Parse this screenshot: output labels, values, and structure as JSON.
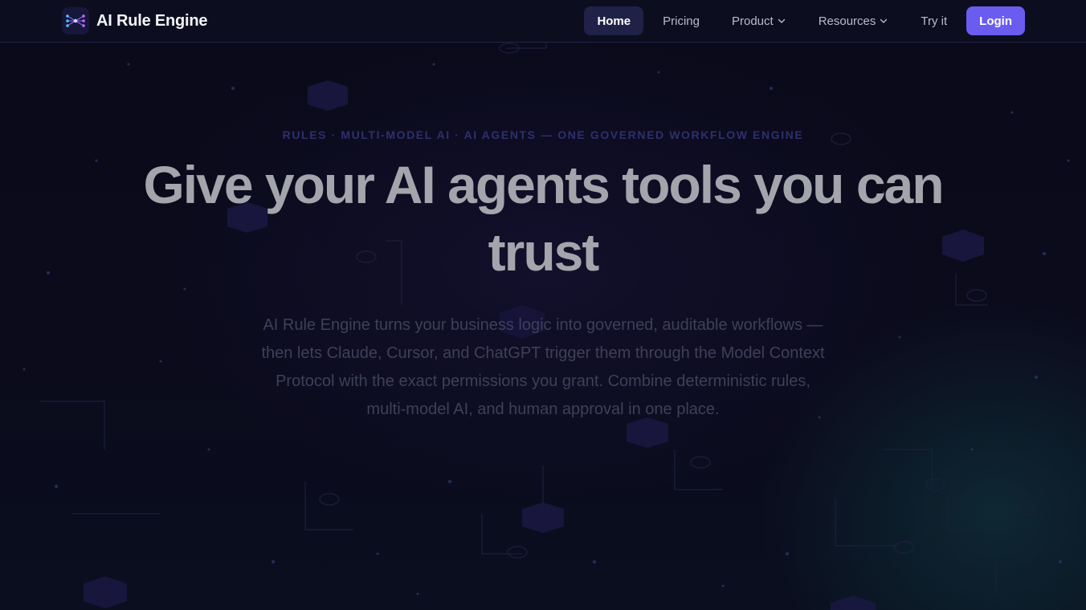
{
  "brand": {
    "name": "AI Rule Engine",
    "logo_icon": "neural-network-logo-icon"
  },
  "nav": {
    "items": [
      {
        "label": "Home",
        "active": true
      },
      {
        "label": "Pricing"
      },
      {
        "label": "Product",
        "has_dropdown": true
      },
      {
        "label": "Resources",
        "has_dropdown": true
      },
      {
        "label": "Try it"
      }
    ],
    "login_label": "Login"
  },
  "hero": {
    "eyebrow": "RULES · MULTI-MODEL AI · AI AGENTS — ONE GOVERNED WORKFLOW ENGINE",
    "headline_line1": "Give your AI agents tools you can",
    "headline_line2": "trust",
    "subtext": "AI Rule Engine turns your business logic into governed, auditable workflows — then lets Claude, Cursor, and ChatGPT trigger them through the Model Context Protocol with the exact permissions you grant. Combine deterministic rules, multi-model AI, and human approval in one place."
  },
  "colors": {
    "background": "#0a0a18",
    "accent": "#6b5cf0",
    "nav_active_bg": "#1f2147",
    "eyebrow": "#2f2f6e",
    "headline": "#a4a5ac"
  }
}
